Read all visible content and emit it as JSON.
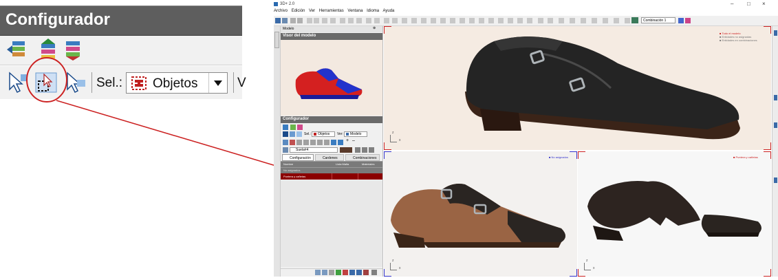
{
  "inset": {
    "panel_title": "Configurador",
    "sel_label": "Sel.:",
    "sel_value": "Objetos"
  },
  "app": {
    "window_title": "3D+ 2.0",
    "menu": [
      "Archivo",
      "Edición",
      "Ver",
      "Herramientas",
      "Ventana",
      "Idioma",
      "Ayuda"
    ],
    "model_panel_tab": "Modelo",
    "model_viewer_title": "Visor del modelo",
    "configurator_title": "Configurador",
    "sel_label": "Sel.:",
    "sel_value": "Objetos",
    "ver_label": "Ver:",
    "ver_value": "Modelo",
    "material_value": "Suela#4",
    "combination_label": "Combinación 1",
    "tabs": [
      "Configuración",
      "Cardenes",
      "Combinaciones"
    ],
    "table_headers": [
      "Nombre",
      "Lista Malla",
      "Materiales"
    ],
    "table_rows": [
      "No asignados",
      "Puntera y cañetas"
    ],
    "viewport_top_legend": [
      "Todo el modelo",
      "Entidades no asignadas",
      "Entidades en combinaciones"
    ],
    "viewport_bl_label": "No asignados",
    "viewport_br_label": "Puntera y cañetas",
    "axis_z": "z",
    "axis_x": "x"
  },
  "colors": {
    "accent_red": "#cc2222",
    "viewport_blue": "#3333cc",
    "table_row_red": "#8b0000"
  }
}
